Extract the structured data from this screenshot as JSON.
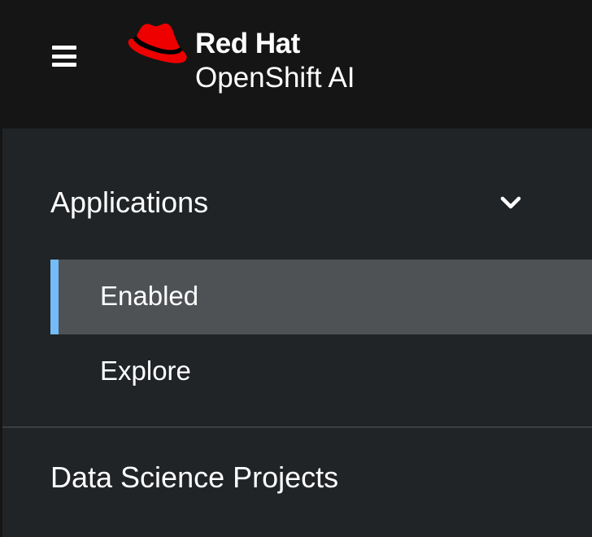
{
  "header": {
    "menu_icon": "hamburger-menu-icon",
    "logo_icon": "red-hat-fedora-icon",
    "brand_line1": "Red Hat",
    "brand_line2": "OpenShift AI",
    "colors": {
      "background": "#151515",
      "logo_red": "#ee0000",
      "text": "#ffffff"
    }
  },
  "sidebar": {
    "sections": [
      {
        "label": "Applications",
        "expanded": true,
        "toggle_icon": "chevron-down-icon",
        "items": [
          {
            "label": "Enabled",
            "active": true
          },
          {
            "label": "Explore",
            "active": false
          }
        ]
      }
    ],
    "links": [
      {
        "label": "Data Science Projects"
      }
    ],
    "colors": {
      "background": "#212427",
      "active_item_background": "#4f5255",
      "active_indicator": "#73bcf7",
      "divider": "#3c3f42"
    }
  }
}
